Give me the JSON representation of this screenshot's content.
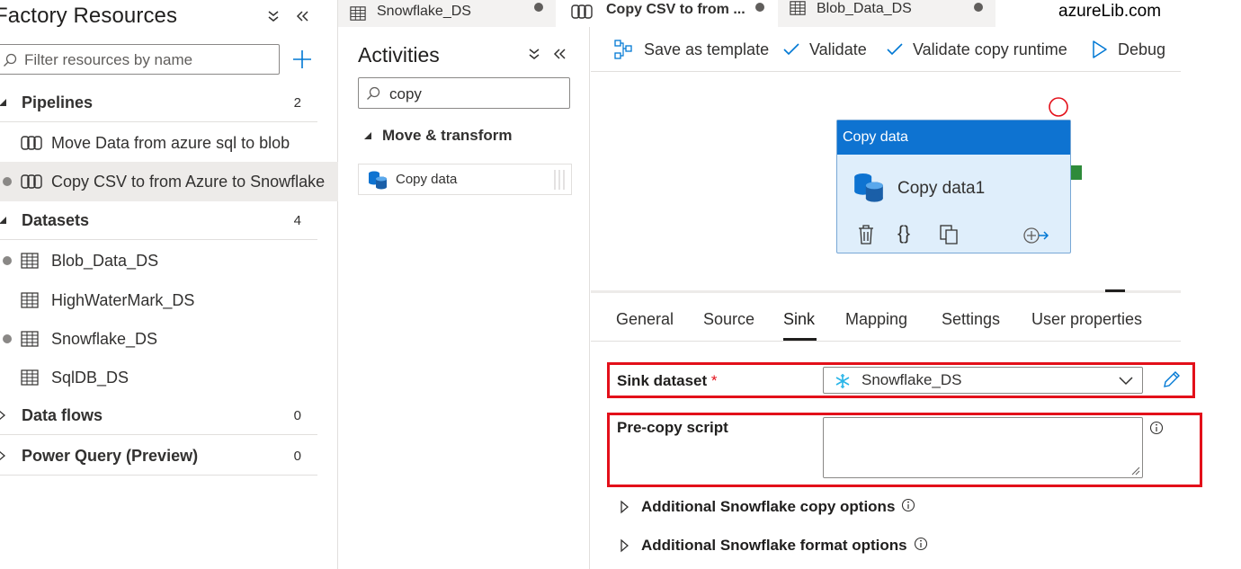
{
  "factory": {
    "title": "Factory Resources",
    "filter_placeholder": "Filter resources by name",
    "categories": [
      {
        "label": "Pipelines",
        "count": "2"
      },
      {
        "label": "Datasets",
        "count": "4"
      },
      {
        "label": "Data flows",
        "count": "0"
      },
      {
        "label": "Power Query (Preview)",
        "count": "0"
      }
    ],
    "pipelines": [
      {
        "label": "Move Data from azure sql to blob"
      },
      {
        "label": "Copy CSV to from Azure to Snowflake"
      }
    ],
    "datasets": [
      {
        "label": "Blob_Data_DS"
      },
      {
        "label": "HighWaterMark_DS"
      },
      {
        "label": "Snowflake_DS"
      },
      {
        "label": "SqlDB_DS"
      }
    ]
  },
  "tabs": [
    {
      "label": "Snowflake_DS"
    },
    {
      "label": "Copy CSV to from ..."
    },
    {
      "label": "Blob_Data_DS"
    }
  ],
  "brand": "azureLib.com",
  "activities": {
    "title": "Activities",
    "search_value": "copy",
    "category": "Move & transform",
    "item": "Copy data"
  },
  "toolbar": {
    "save_template": "Save as template",
    "validate": "Validate",
    "validate_copy": "Validate copy runtime",
    "debug": "Debug"
  },
  "node": {
    "type": "Copy data",
    "name": "Copy data1"
  },
  "properties": {
    "tabs": [
      "General",
      "Source",
      "Sink",
      "Mapping",
      "Settings",
      "User properties"
    ],
    "active_tab": "Sink",
    "sink_dataset_label": "Sink dataset",
    "required_mark": "*",
    "sink_dataset_value": "Snowflake_DS",
    "precopy_label": "Pre-copy script",
    "precopy_value": "",
    "additional_copy": "Additional Snowflake copy options",
    "additional_format": "Additional Snowflake format options"
  },
  "colors": {
    "accent": "#0078d4",
    "node_header": "#0e73d1",
    "highlight_red": "#e3101a"
  }
}
